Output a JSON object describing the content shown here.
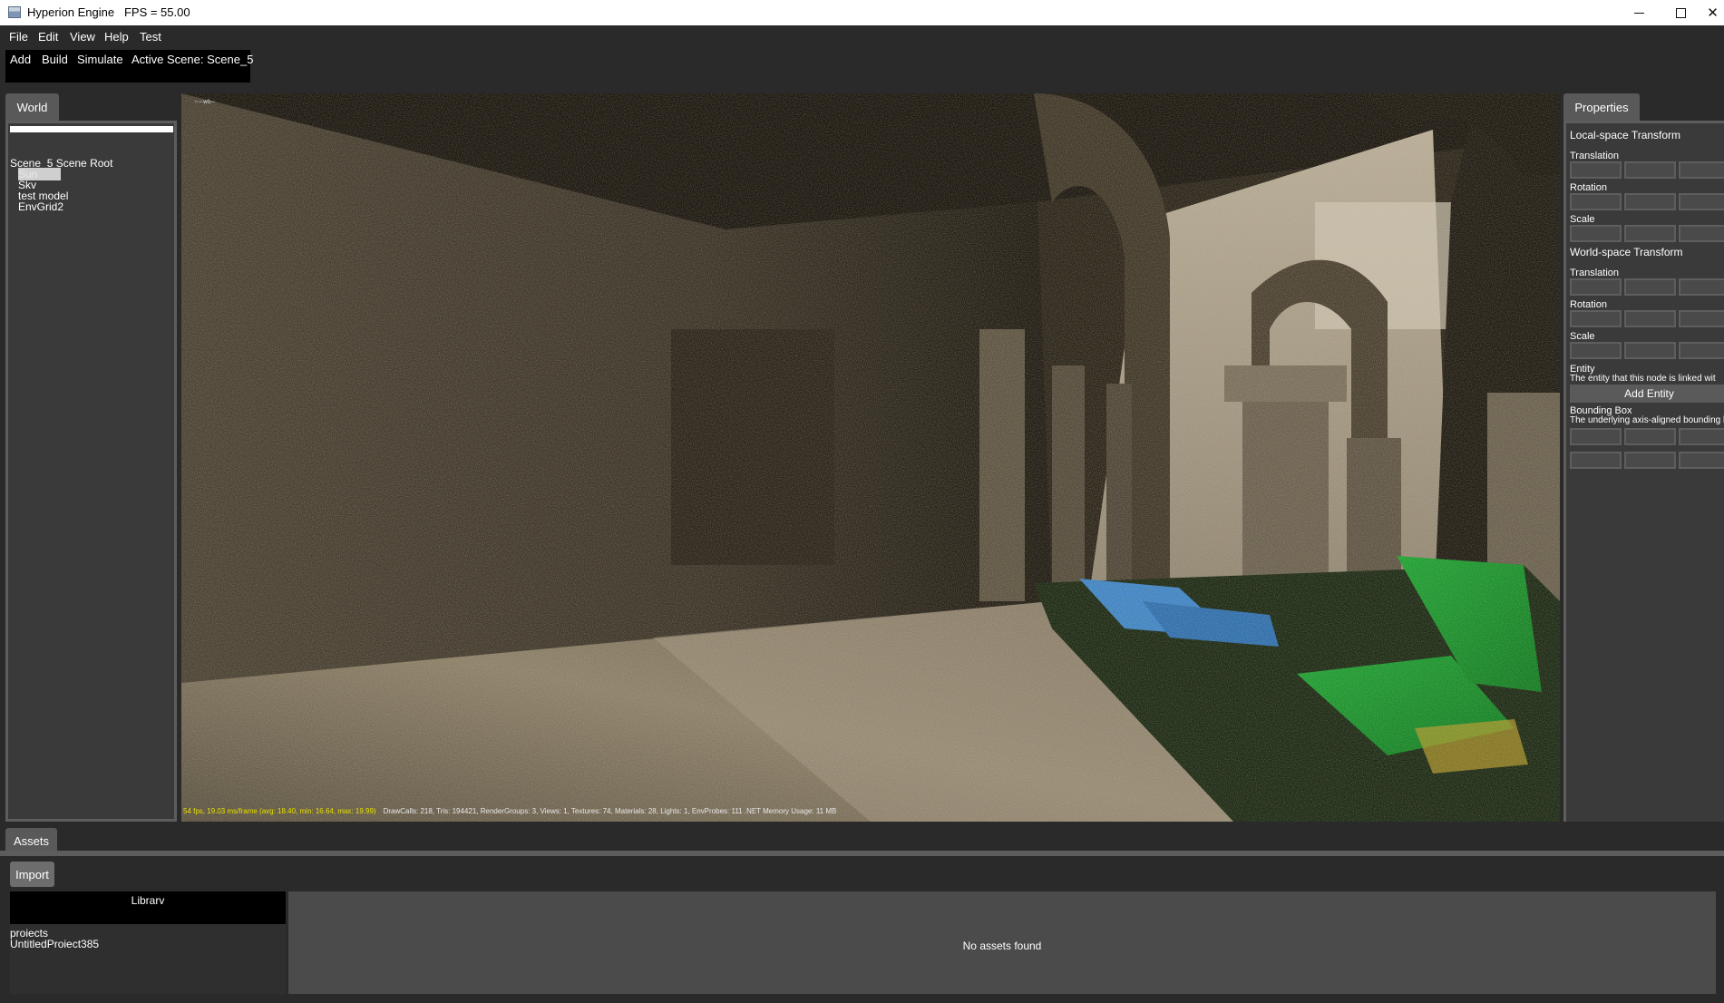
{
  "window": {
    "title": "Hyperion Engine   FPS = 55.00",
    "icon": "app-window-icon",
    "controls": {
      "minimize": "minimize-icon",
      "maximize": "maximize-icon",
      "close": "✕"
    }
  },
  "menu": {
    "items": [
      "File",
      "Edit",
      "View",
      "Help",
      "Test"
    ]
  },
  "toolbar": {
    "add": "Add",
    "build": "Build",
    "simulate": "Simulate",
    "active_scene": "Active Scene: Scene_5"
  },
  "world": {
    "tab": "World",
    "search_value": "",
    "root": "Scene_5 Scene Root",
    "children": [
      "Sun",
      "Skv",
      "test model",
      "EnvGrid2"
    ],
    "selected": "Sun"
  },
  "viewport": {
    "corner_text": "~~wb~",
    "stats_fps": "54 fps, 19.03 ms/frame (avg: 18.40, min: 16.64, max: 19.99)",
    "stats_draw": "DrawCalls: 218, Tris: 194421, RenderGroups: 3, Views: 1, Textures: 74, Materials: 28, Lights: 1, EnvProbes: 111  .NET Memory Usage: 11 MB",
    "colors": {
      "stone": "#6f6555",
      "floor": "#9a8e78",
      "dark": "#1e1a12",
      "cloth_blue": "#3f85c6",
      "cloth_green": "#1fa334"
    }
  },
  "properties": {
    "tab": "Properties",
    "local_heading": "Local-space Transform",
    "world_heading": "World-space Transform",
    "translation": "Translation",
    "rotation": "Rotation",
    "scale": "Scale",
    "entity_heading": "Entity",
    "entity_desc": "The entity that this node is linked wit",
    "add_entity": "Add Entity",
    "bbox_heading": "Bounding Box",
    "bbox_desc": "The underlying axis-aligned bounding b"
  },
  "assets": {
    "tab": "Assets",
    "import": "Import",
    "library_header": "Librarv",
    "library_items": [
      "proiects",
      "UntitledProiect385"
    ],
    "empty": "No assets found"
  }
}
